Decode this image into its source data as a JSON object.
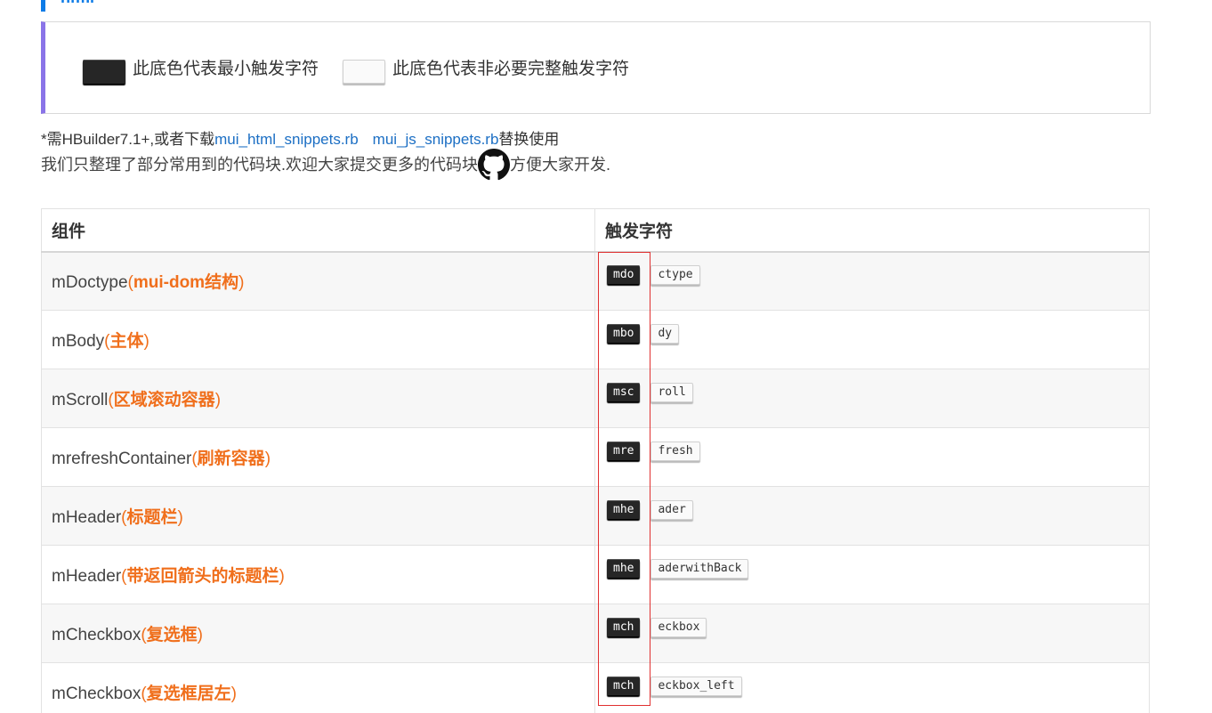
{
  "heading": "html",
  "legend": {
    "min_trigger_label": "此底色代表最小触发字符",
    "optional_label": "此底色代表非必要完整触发字符"
  },
  "note": {
    "prefix": "*需HBuilder7.1+,或者下载",
    "link1": "mui_html_snippets.rb",
    "link2": "mui_js_snippets.rb",
    "suffix": "替换使用"
  },
  "intro": {
    "before": "我们只整理了部分常用到的代码块.欢迎大家提交更多的代码块",
    "after": "方便大家开发.",
    "icon": "github-icon"
  },
  "table": {
    "headers": [
      "组件",
      "触发字符"
    ],
    "rows": [
      {
        "name": "mDoctype",
        "desc": "mui-dom结构",
        "min": "mdo",
        "rest": "ctype"
      },
      {
        "name": "mBody",
        "desc": "主体",
        "min": "mbo",
        "rest": "dy"
      },
      {
        "name": "mScroll",
        "desc": "区域滚动容器",
        "min": "msc",
        "rest": "roll"
      },
      {
        "name": "mrefreshContainer",
        "desc": "刷新容器",
        "min": "mre",
        "rest": "fresh"
      },
      {
        "name": "mHeader",
        "desc": "标题栏",
        "min": "mhe",
        "rest": "ader"
      },
      {
        "name": "mHeader",
        "desc": "带返回箭头的标题栏",
        "min": "mhe",
        "rest": "aderwithBack"
      },
      {
        "name": "mCheckbox",
        "desc": "复选框",
        "min": "mch",
        "rest": "eckbox"
      },
      {
        "name": "mCheckbox",
        "desc": "复选框居左",
        "min": "mch",
        "rest": "eckbox_left"
      }
    ]
  },
  "colors": {
    "accent_blue": "#0e7ce7",
    "legend_border": "#8a74e8",
    "desc_orange": "#f06f1c",
    "highlight_red": "#e03030"
  }
}
